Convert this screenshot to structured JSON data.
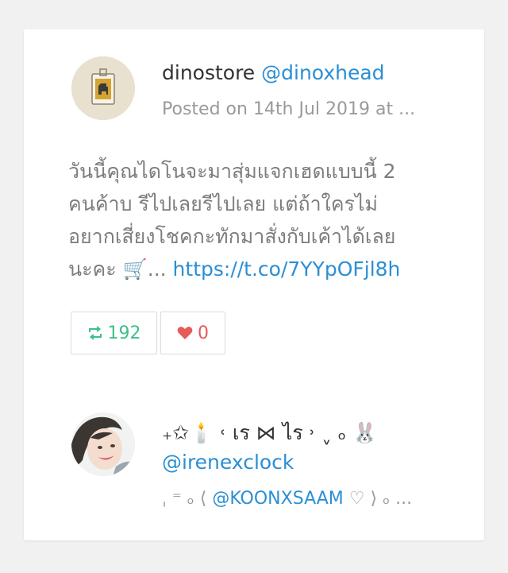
{
  "tweet": {
    "display_name": "dinostore",
    "handle": "@dinoxhead",
    "meta": "Posted on 14th Jul 2019 at ...",
    "body_lines": [
      "วันนี้คุณไดโนจะมาสุ่มแจกเฮดแบบนี้ 2",
      "คนค้าบ รีไปเลยรีไปเลย แต่ถ้าใครไม่",
      "อยากเสี่ยงโชคกะทักมาสั่งกับเค้าได้เลย"
    ],
    "body_last_prefix": "นะคะ 🛒...",
    "link": "https://t.co/7YYpOFjl8h",
    "retweets": "192",
    "likes": "0",
    "retweet_icon": "retweet-icon",
    "like_icon": "heart-icon"
  },
  "user2": {
    "display_name": "₊✩🕯️ ˓ เร ⋈ ไร ˒ ˬ ₒ 🐰",
    "handle": "@irenexclock",
    "bio_prefix": "ˌ ⁼ ₒ ⟨",
    "bio_mention": "@KOONXSAAM",
    "bio_suffix": "♡ ⟩ ₒ ..."
  },
  "colors": {
    "accent_link": "#2b8fd4",
    "retweet_green": "#3fbf86",
    "like_red": "#e65a5a",
    "muted_text": "#9a9a9a",
    "body_text": "#7d7d7d",
    "background": "#f1f1f1",
    "card": "#ffffff"
  }
}
